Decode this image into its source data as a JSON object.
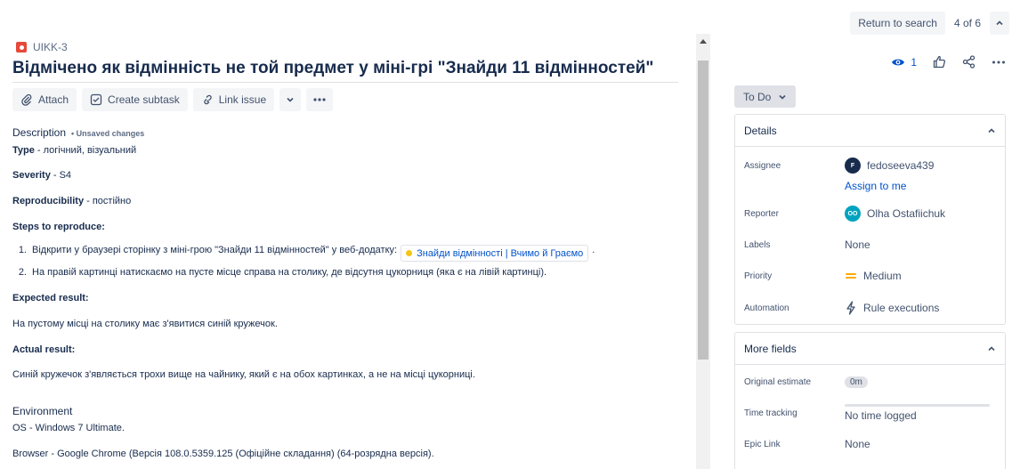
{
  "nav": {
    "return_label": "Return to search",
    "counter": "4 of 6"
  },
  "issue": {
    "key": "UIKK-3",
    "title": "Відмічено як відмінність не той предмет у міні-грі \"Знайди 11 відмінностей\""
  },
  "actions": {
    "attach": "Attach",
    "create_subtask": "Create subtask",
    "link_issue": "Link issue"
  },
  "description": {
    "label": "Description",
    "unsaved": "• Unsaved changes",
    "type_label": "Type",
    "type_value": " - логічний, візуальний",
    "severity_label": "Severity",
    "severity_value": " - S4",
    "repro_label": "Reproducibility",
    "repro_value": " - постійно",
    "steps_label": "Steps to reproduce:",
    "step1_num": "1.",
    "step1_text": "Відкрити у браузері сторінку з міні-грою \"Знайди 11 відмінностей\" у веб-додатку:",
    "step1_link": "Знайди відмінності | Вчимо й Граємо",
    "step1_end": ".",
    "step2_num": "2.",
    "step2_text": "На правій картинці натискаємо на пусте місце справа на столику, де відсутня цукорниця (яка є на лівій картинці).",
    "expected_label": "Expected result:",
    "expected_text": "На пустому місці на столику має з'явитися синій кружечок.",
    "actual_label": "Actual result:",
    "actual_text": "Синій кружечок з'являється трохи вище на чайнику, який є на обох картинках, а не на місці цукорниці.",
    "env_label": "Environment",
    "os": "OS - Windows 7 Ultimate.",
    "browser": "Browser - Google Chrome (Версія 108.0.5359.125 (Офіційне складання) (64-розрядна версія)."
  },
  "sidebar": {
    "watch_count": "1",
    "status": "To Do",
    "details_title": "Details",
    "assignee_label": "Assignee",
    "assignee_initial": "F",
    "assignee_name": "fedoseeva439",
    "assign_to_me": "Assign to me",
    "reporter_label": "Reporter",
    "reporter_initials": "OO",
    "reporter_name": "Olha Ostafiichuk",
    "labels_label": "Labels",
    "labels_value": "None",
    "priority_label": "Priority",
    "priority_value": "Medium",
    "automation_label": "Automation",
    "automation_value": "Rule executions",
    "more_fields_title": "More fields",
    "orig_est_label": "Original estimate",
    "orig_est_value": "0m",
    "time_tracking_label": "Time tracking",
    "time_tracking_value": "No time logged",
    "epic_link_label": "Epic Link",
    "epic_link_value": "None"
  },
  "colors": {
    "accent": "#0052cc",
    "bug": "#e5493a",
    "priority_medium": "#ffab00",
    "assignee_avatar": "#172b4d",
    "reporter_avatar": "#00a3bf"
  }
}
